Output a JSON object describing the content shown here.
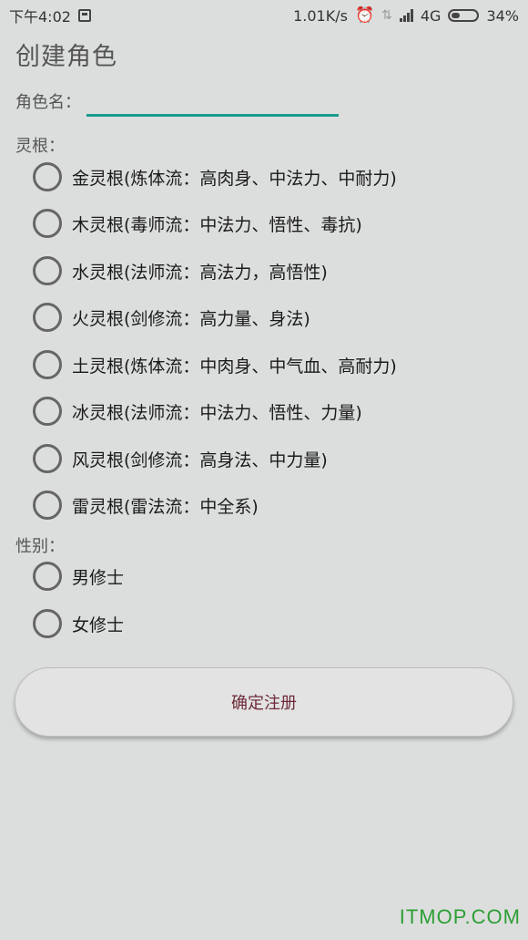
{
  "status_bar": {
    "time": "下午4:02",
    "network_speed": "1.01K/s",
    "network_type": "4G",
    "battery_percent": "34%",
    "icons": [
      "sim-icon",
      "alarm-icon",
      "data-transfer-icon",
      "signal-icon",
      "battery-icon"
    ]
  },
  "page": {
    "title": "创建角色"
  },
  "name_field": {
    "label": "角色名：",
    "value": "",
    "accent_color": "#1c9b8e"
  },
  "root_section": {
    "label": "灵根：",
    "options": [
      {
        "label": "金灵根(炼体流：高肉身、中法力、中耐力)",
        "selected": false
      },
      {
        "label": "木灵根(毒师流：中法力、悟性、毒抗)",
        "selected": false
      },
      {
        "label": "水灵根(法师流：高法力，高悟性)",
        "selected": false
      },
      {
        "label": "火灵根(剑修流：高力量、身法)",
        "selected": false
      },
      {
        "label": "土灵根(炼体流：中肉身、中气血、高耐力)",
        "selected": false
      },
      {
        "label": "冰灵根(法师流：中法力、悟性、力量)",
        "selected": false
      },
      {
        "label": "风灵根(剑修流：高身法、中力量)",
        "selected": false
      },
      {
        "label": "雷灵根(雷法流：中全系)",
        "selected": false
      }
    ]
  },
  "gender_section": {
    "label": "性别：",
    "options": [
      {
        "label": "男修士",
        "selected": false
      },
      {
        "label": "女修士",
        "selected": false
      }
    ]
  },
  "submit_button": {
    "label": "确定注册"
  },
  "watermark": {
    "text": "ITMOP.COM"
  }
}
